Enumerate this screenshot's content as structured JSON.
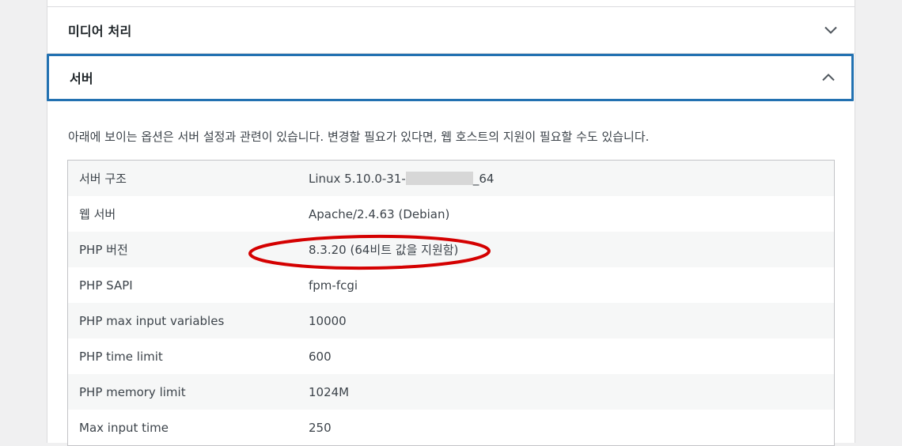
{
  "sections": {
    "media": {
      "title": "미디어 처리",
      "expanded": false,
      "icon": "chevron-down-icon"
    },
    "server": {
      "title": "서버",
      "expanded": true,
      "icon": "chevron-up-icon"
    }
  },
  "server_description": "아래에 보이는 옵션은 서버 설정과 관련이 있습니다. 변경할 필요가 있다면, 웹 호스트의 지원이 필요할 수도 있습니다.",
  "server_info": {
    "rows": [
      {
        "label": "서버 구조",
        "value_prefix": "Linux 5.10.0-31-",
        "value_suffix": "_64",
        "redacted": true
      },
      {
        "label": "웹 서버",
        "value": "Apache/2.4.63 (Debian)"
      },
      {
        "label": "PHP 버전",
        "value": "8.3.20 (64비트 값을 지원함)",
        "highlighted": true
      },
      {
        "label": "PHP SAPI",
        "value": "fpm-fcgi"
      },
      {
        "label": "PHP max input variables",
        "value": "10000"
      },
      {
        "label": "PHP time limit",
        "value": "600"
      },
      {
        "label": "PHP memory limit",
        "value": "1024M"
      },
      {
        "label": "Max input time",
        "value": "250"
      }
    ]
  },
  "colors": {
    "focus_border": "#2271b1",
    "annotation_circle": "#d40000",
    "row_alt": "#f6f7f7"
  }
}
